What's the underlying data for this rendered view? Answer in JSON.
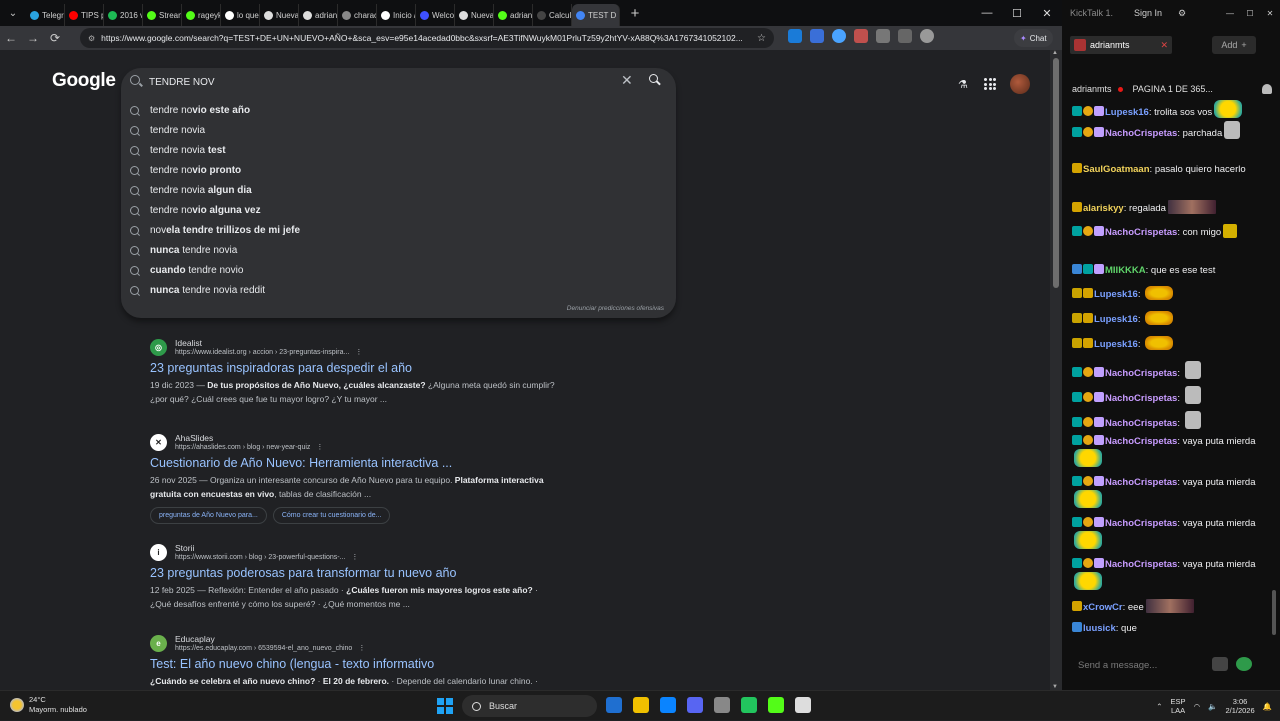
{
  "browser": {
    "tabs": [
      {
        "label": "Telegr",
        "color": "#2aa3e0"
      },
      {
        "label": "TIPS p",
        "color": "#ff0000"
      },
      {
        "label": "2016 v",
        "color": "#1db954"
      },
      {
        "label": "Stream",
        "color": "#53fc18"
      },
      {
        "label": "rageyk",
        "color": "#53fc18"
      },
      {
        "label": "lo que",
        "color": "#ffffff"
      },
      {
        "label": "Nueva",
        "color": "#dddddd"
      },
      {
        "label": "adrian",
        "color": "#dddddd"
      },
      {
        "label": "charac",
        "color": "#888888"
      },
      {
        "label": "Inicio /",
        "color": "#ffffff"
      },
      {
        "label": "Welco",
        "color": "#3f51ff"
      },
      {
        "label": "Nueva",
        "color": "#dddddd"
      },
      {
        "label": "adrian",
        "color": "#53fc18"
      },
      {
        "label": "Calcul",
        "color": "#444444"
      },
      {
        "label": "TEST D",
        "color": "#4285f4"
      }
    ],
    "active_tab_index": 14,
    "url": "https://www.google.com/search?q=TEST+DE+UN+NUEVO+AÑO+&sca_esv=e95e14acedad0bbc&sxsrf=AE3TifNWuykM01PrluTz59y2htYV-xA88Q%3A1767341052102...",
    "chat_label": "Chat"
  },
  "google": {
    "logo": "Google",
    "query": "TENDRE NOV",
    "suggestions": [
      {
        "pre": "tendre no",
        "normal": "",
        "bold": "vio este año"
      },
      {
        "pre": "tendre novia",
        "normal": "",
        "bold": ""
      },
      {
        "pre": "tendre novia ",
        "normal": "",
        "bold": "test"
      },
      {
        "pre": "tendre no",
        "normal": "",
        "bold": "vio pronto"
      },
      {
        "pre": "tendre novia ",
        "normal": "",
        "bold": "algun dia"
      },
      {
        "pre": "tendre no",
        "normal": "",
        "bold": "vio alguna vez"
      },
      {
        "pre": "nov",
        "normal": "",
        "bold": "ela tendre trillizos de mi jefe"
      },
      {
        "pre": "",
        "normal": "",
        "bold": "nunca",
        "post": " tendre novia"
      },
      {
        "pre": "",
        "normal": "",
        "bold": "cuando",
        "post": " tendre novio"
      },
      {
        "pre": "",
        "normal": "",
        "bold": "nunca",
        "post": " tendre novia reddit"
      }
    ],
    "report_text": "Denunciar predicciones ofensivas"
  },
  "results": [
    {
      "site": "Idealist",
      "url": "https://www.idealist.org › accion › 23-preguntas-inspira...",
      "title": "23 preguntas inspiradoras para despedir el año",
      "snippet_date": "19 dic 2023 — ",
      "snippet_bold": "De tus propósitos de Año Nuevo, ¿cuáles alcanzaste?",
      "snippet_rest": " ¿Alguna meta quedó sin cumplir? ¿por qué? ¿Cuál crees que fue tu mayor logro? ¿Y tu mayor ...",
      "fav_color": "#2e9a4a",
      "fav_char": "◎"
    },
    {
      "site": "AhaSlides",
      "url": "https://ahaslides.com › blog › new-year-quiz",
      "title": "Cuestionario de Año Nuevo: Herramienta interactiva ...",
      "snippet_date": "26 nov 2025 — ",
      "snippet_pre": "Organiza un interesante concurso de Año Nuevo para tu equipo. ",
      "snippet_bold": "Plataforma interactiva gratuita con encuestas en vivo",
      "snippet_rest": ", tablas de clasificación ...",
      "chips": [
        "preguntas de Año Nuevo para...",
        "Cómo crear tu cuestionario de..."
      ],
      "fav_color": "#ffffff",
      "fav_char": "✕"
    },
    {
      "site": "Storii",
      "url": "https://www.storii.com › blog › 23-powerful-questions-...",
      "title": "23 preguntas poderosas para transformar tu nuevo año",
      "snippet_date": "12 feb 2025 — ",
      "snippet_pre": "Reflexión: Entender el año pasado · ",
      "snippet_bold": "¿Cuáles fueron mis mayores logros este año?",
      "snippet_rest": " · ¿Qué desafíos enfrenté y cómo los superé? · ¿Qué momentos me ...",
      "fav_color": "#ffffff",
      "fav_char": "i"
    },
    {
      "site": "Educaplay",
      "url": "https://es.educaplay.com › 6539594-el_ano_nuevo_chino",
      "title": "Test: El año nuevo chino (lengua - texto informativo",
      "snippet_bold": "¿Cuándo se celebra el año nuevo chino?",
      "snippet_pre": "",
      "snippet_date": "",
      "snippet_mid": " · ",
      "snippet_bold2": "El 20 de febrero.",
      "snippet_rest": " · Depende del calendario lunar chino. ·",
      "fav_color": "#6ab04c",
      "fav_char": "e"
    }
  ],
  "kicktalk": {
    "app": "KickTalk 1.",
    "signin": "Sign In",
    "channel_tab": "adrianmts",
    "add_label": "Add",
    "channel": "adrianmts",
    "page_indicator": "PAGINA 1 DE 365...",
    "messages": [
      {
        "user": "Lupesk16",
        "color": "#7aa0ff",
        "text": "trolita sos vos",
        "badges": [
          "b-gift",
          "b-one",
          "b-fig"
        ],
        "emote": "grin"
      },
      {
        "user": "NachoCrispetas",
        "color": "#c89cff",
        "text": "parchada",
        "badges": [
          "b-gift",
          "b-one",
          "b-fig"
        ],
        "emote": "face"
      },
      {
        "user": "SaulGoatmaan",
        "color": "#f2d35c",
        "text": "pasalo quiero hacerlo",
        "badges": [
          "b-crown"
        ],
        "emote": ""
      },
      {
        "user": "alariskyy",
        "color": "#f2d35c",
        "text": "regalada",
        "badges": [
          "b-crown"
        ],
        "emote": "pic"
      },
      {
        "user": "NachoCrispetas",
        "color": "#c89cff",
        "text": "con migo",
        "badges": [
          "b-gift",
          "b-one",
          "b-fig"
        ],
        "emote": "small"
      },
      {
        "user": "MIIKKKA",
        "color": "#5fd36a",
        "text": "que es ese test",
        "badges": [
          "b-x",
          "b-gift",
          "b-fig"
        ],
        "emote": ""
      },
      {
        "user": "Lupesk16",
        "color": "#7aa0ff",
        "text": "",
        "badges": [
          "b-mask",
          "b-crown"
        ],
        "emote": "burger"
      },
      {
        "user": "Lupesk16",
        "color": "#7aa0ff",
        "text": "",
        "badges": [
          "b-mask",
          "b-crown"
        ],
        "emote": "burger"
      },
      {
        "user": "Lupesk16",
        "color": "#7aa0ff",
        "text": "",
        "badges": [
          "b-mask",
          "b-crown"
        ],
        "emote": "burger"
      },
      {
        "user": "NachoCrispetas",
        "color": "#c89cff",
        "text": "",
        "badges": [
          "b-gift",
          "b-one",
          "b-fig"
        ],
        "emote": "face"
      },
      {
        "user": "NachoCrispetas",
        "color": "#c89cff",
        "text": "",
        "badges": [
          "b-gift",
          "b-one",
          "b-fig"
        ],
        "emote": "face"
      },
      {
        "user": "NachoCrispetas",
        "color": "#c89cff",
        "text": "",
        "badges": [
          "b-gift",
          "b-one",
          "b-fig"
        ],
        "emote": "face"
      },
      {
        "user": "NachoCrispetas",
        "color": "#c89cff",
        "text": "vaya puta mierda",
        "badges": [
          "b-gift",
          "b-one",
          "b-fig"
        ],
        "emote": "grin"
      },
      {
        "user": "NachoCrispetas",
        "color": "#c89cff",
        "text": "vaya puta mierda",
        "badges": [
          "b-gift",
          "b-one",
          "b-fig"
        ],
        "emote": "grin"
      },
      {
        "user": "NachoCrispetas",
        "color": "#c89cff",
        "text": "vaya puta mierda",
        "badges": [
          "b-gift",
          "b-one",
          "b-fig"
        ],
        "emote": "grin"
      },
      {
        "user": "NachoCrispetas",
        "color": "#c89cff",
        "text": "vaya puta mierda",
        "badges": [
          "b-gift",
          "b-one",
          "b-fig"
        ],
        "emote": "grin"
      },
      {
        "user": "xCrowCr",
        "color": "#7aa0ff",
        "text": "eee",
        "badges": [
          "b-crown"
        ],
        "emote": "pic"
      },
      {
        "user": "luusick",
        "color": "#7aa0ff",
        "text": "que",
        "badges": [
          "b-x"
        ],
        "emote": ""
      }
    ],
    "send_placeholder": "Send a message..."
  },
  "taskbar": {
    "temp": "24°C",
    "weather": "Mayorm. nublado",
    "search": "Buscar",
    "lang1": "ESP",
    "lang2": "LAA",
    "time": "3:06",
    "date": "2/1/2026",
    "apps": [
      "#1f6fd0",
      "#f0c000",
      "#0a84ff",
      "#5865f2",
      "#888888",
      "#22c55e",
      "#53fc18",
      "#dddddd"
    ]
  }
}
